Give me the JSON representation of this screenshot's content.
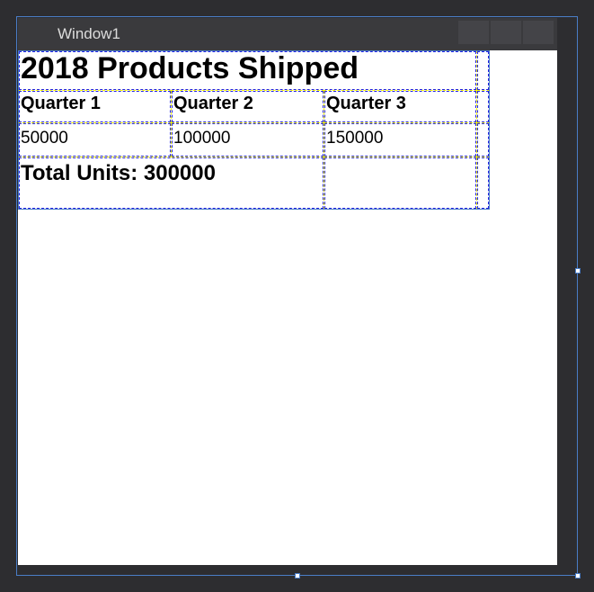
{
  "window": {
    "title": "Window1"
  },
  "content": {
    "heading": "2018 Products Shipped",
    "columns": {
      "c1": "Quarter 1",
      "c2": "Quarter 2",
      "c3": "Quarter 3"
    },
    "values": {
      "v1": "50000",
      "v2": "100000",
      "v3": "150000"
    },
    "total_label": "Total Units: 300000"
  },
  "chart_data": {
    "type": "table",
    "title": "2018 Products Shipped",
    "categories": [
      "Quarter 1",
      "Quarter 2",
      "Quarter 3"
    ],
    "values": [
      50000,
      100000,
      150000
    ],
    "total": 300000
  }
}
